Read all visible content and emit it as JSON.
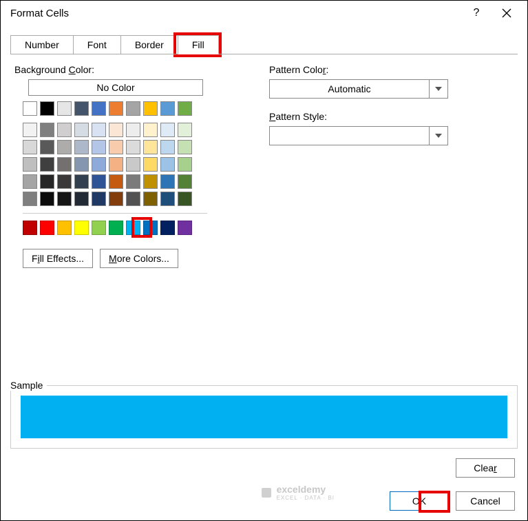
{
  "title": "Format Cells",
  "tabs": {
    "number": "Number",
    "font": "Font",
    "border": "Border",
    "fill": "Fill"
  },
  "labels": {
    "bg_pre": "Background ",
    "bg_u": "C",
    "bg_post": "olor:",
    "no_color": "No Color",
    "pc_pre": "Pattern Colo",
    "pc_u": "r",
    "pc_post": ":",
    "ps_pre": "",
    "ps_u": "P",
    "ps_post": "attern Style:",
    "automatic": "Automatic",
    "fe_pre": "Fill Effects",
    "fe_u": "I",
    "fe_post": "...",
    "mc_pre": "",
    "mc_u": "M",
    "mc_post": "ore Colors...",
    "sample": "Sample",
    "clear_pre": "Clea",
    "clear_u": "r",
    "ok": "OK",
    "cancel": "Cancel"
  },
  "theme_rows": [
    [
      "#ffffff",
      "#000000",
      "#e7e6e6",
      "#44546a",
      "#4472c4",
      "#ed7d31",
      "#a5a5a5",
      "#ffc000",
      "#5b9bd5",
      "#70ad47"
    ],
    [
      "#f2f2f2",
      "#7f7f7f",
      "#d0cece",
      "#d6dce4",
      "#d9e2f3",
      "#fbe5d5",
      "#ededed",
      "#fff2cc",
      "#deebf6",
      "#e2efd9"
    ],
    [
      "#d8d8d8",
      "#595959",
      "#aeabab",
      "#adb9ca",
      "#b4c6e7",
      "#f7cbac",
      "#dbdbdb",
      "#fee599",
      "#bdd7ee",
      "#c5e0b3"
    ],
    [
      "#bfbfbf",
      "#3f3f3f",
      "#757070",
      "#8496b0",
      "#8eaadb",
      "#f4b183",
      "#c9c9c9",
      "#ffd965",
      "#9cc3e5",
      "#a8d08d"
    ],
    [
      "#a5a5a5",
      "#262626",
      "#3a3838",
      "#323f4f",
      "#2f5496",
      "#c55a11",
      "#7b7b7b",
      "#bf9000",
      "#2e75b5",
      "#538135"
    ],
    [
      "#7f7f7f",
      "#0c0c0c",
      "#171616",
      "#222a35",
      "#1f3864",
      "#833c0b",
      "#525252",
      "#7f6000",
      "#1e4e79",
      "#375623"
    ]
  ],
  "standard_colors": [
    "#c00000",
    "#ff0000",
    "#ffc000",
    "#ffff00",
    "#92d050",
    "#00b050",
    "#00b0f0",
    "#0070c0",
    "#002060",
    "#7030a0"
  ],
  "selected_color": "#00b0f0",
  "watermark": {
    "brand": "exceldemy",
    "tag": "EXCEL · DATA · BI"
  }
}
